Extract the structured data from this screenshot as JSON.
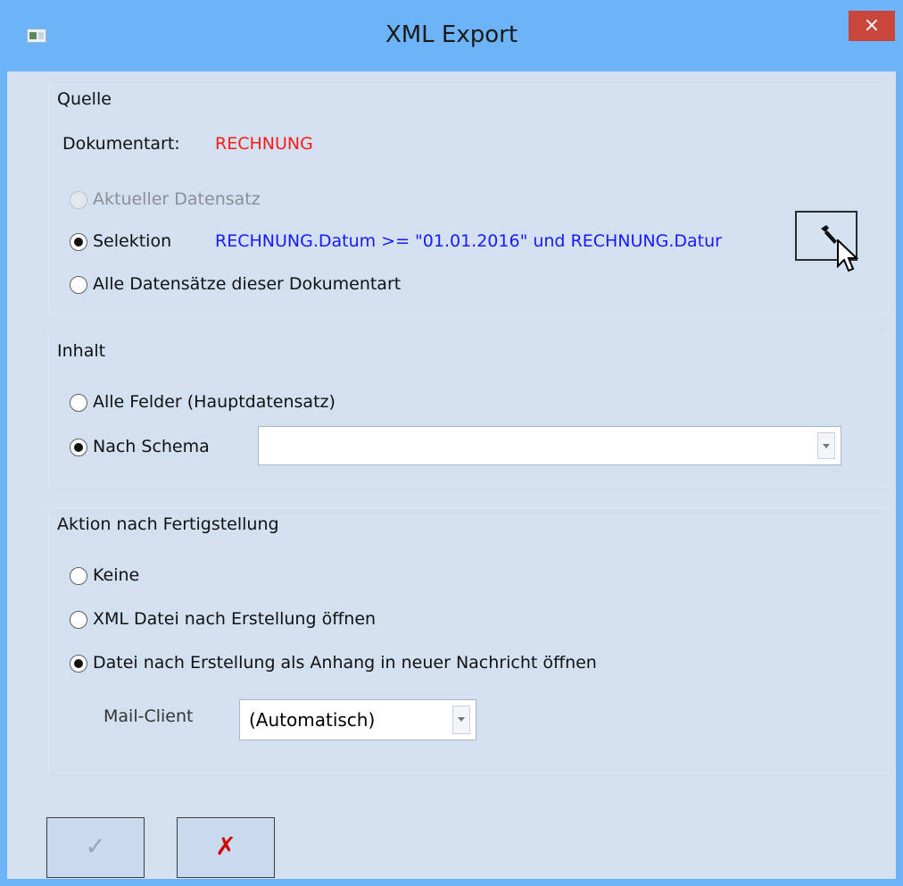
{
  "window": {
    "title": "XML Export",
    "close_glyph": "×"
  },
  "quelle": {
    "title": "Quelle",
    "dokumentart_label": "Dokumentart:",
    "dokumentart_value": "RECHNUNG",
    "options": {
      "aktueller": "Aktueller Datensatz",
      "selektion": "Selektion",
      "alle": "Alle Datensätze dieser Dokumentart"
    },
    "selection_text": "RECHNUNG.Datum >= \"01.01.2016\" und RECHNUNG.Datur",
    "selected": "selektion"
  },
  "inhalt": {
    "title": "Inhalt",
    "options": {
      "alle_felder": "Alle Felder (Hauptdatensatz)",
      "nach_schema": "Nach Schema"
    },
    "schema_value": "",
    "selected": "nach_schema"
  },
  "aktion": {
    "title": "Aktion nach Fertigstellung",
    "options": {
      "keine": "Keine",
      "xml_oeffnen": "XML Datei nach Erstellung öffnen",
      "anhang": "Datei nach Erstellung als Anhang in neuer Nachricht öffnen"
    },
    "selected": "anhang",
    "mail_client_label": "Mail-Client",
    "mail_client_value": "(Automatisch)"
  },
  "buttons": {
    "ok_glyph": "✓",
    "cancel_glyph": "✗"
  },
  "colors": {
    "titlebar": "#6cb3f7",
    "client": "#d3e0ef",
    "close": "#c9463d",
    "doc_type": "#ff1a1a",
    "selection_text": "#1919ff"
  },
  "icons": {
    "tool_button": "wrench-icon",
    "cursor": "mouse-pointer-icon",
    "app": "app-window-icon"
  }
}
